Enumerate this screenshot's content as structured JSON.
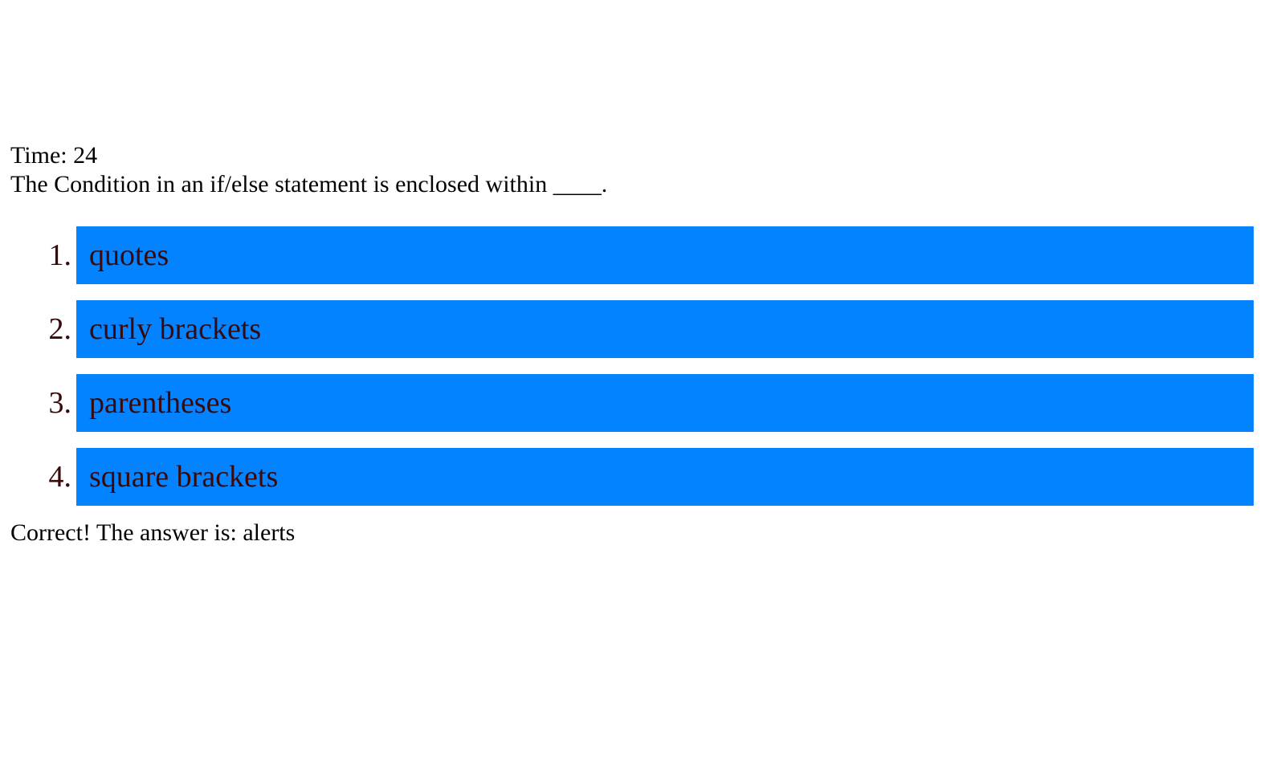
{
  "timer": {
    "label": "Time: 24"
  },
  "question": {
    "text": "The Condition in an if/else statement is enclosed within ____."
  },
  "choices": [
    {
      "number": "1.",
      "label": "quotes"
    },
    {
      "number": "2.",
      "label": "curly brackets"
    },
    {
      "number": "3.",
      "label": "parentheses"
    },
    {
      "number": "4.",
      "label": "square brackets"
    }
  ],
  "feedback": {
    "text": "Correct! The answer is: alerts"
  },
  "colors": {
    "choice_background": "#0383ff",
    "choice_text": "#3a0a0a",
    "page_background": "#ffffff"
  }
}
